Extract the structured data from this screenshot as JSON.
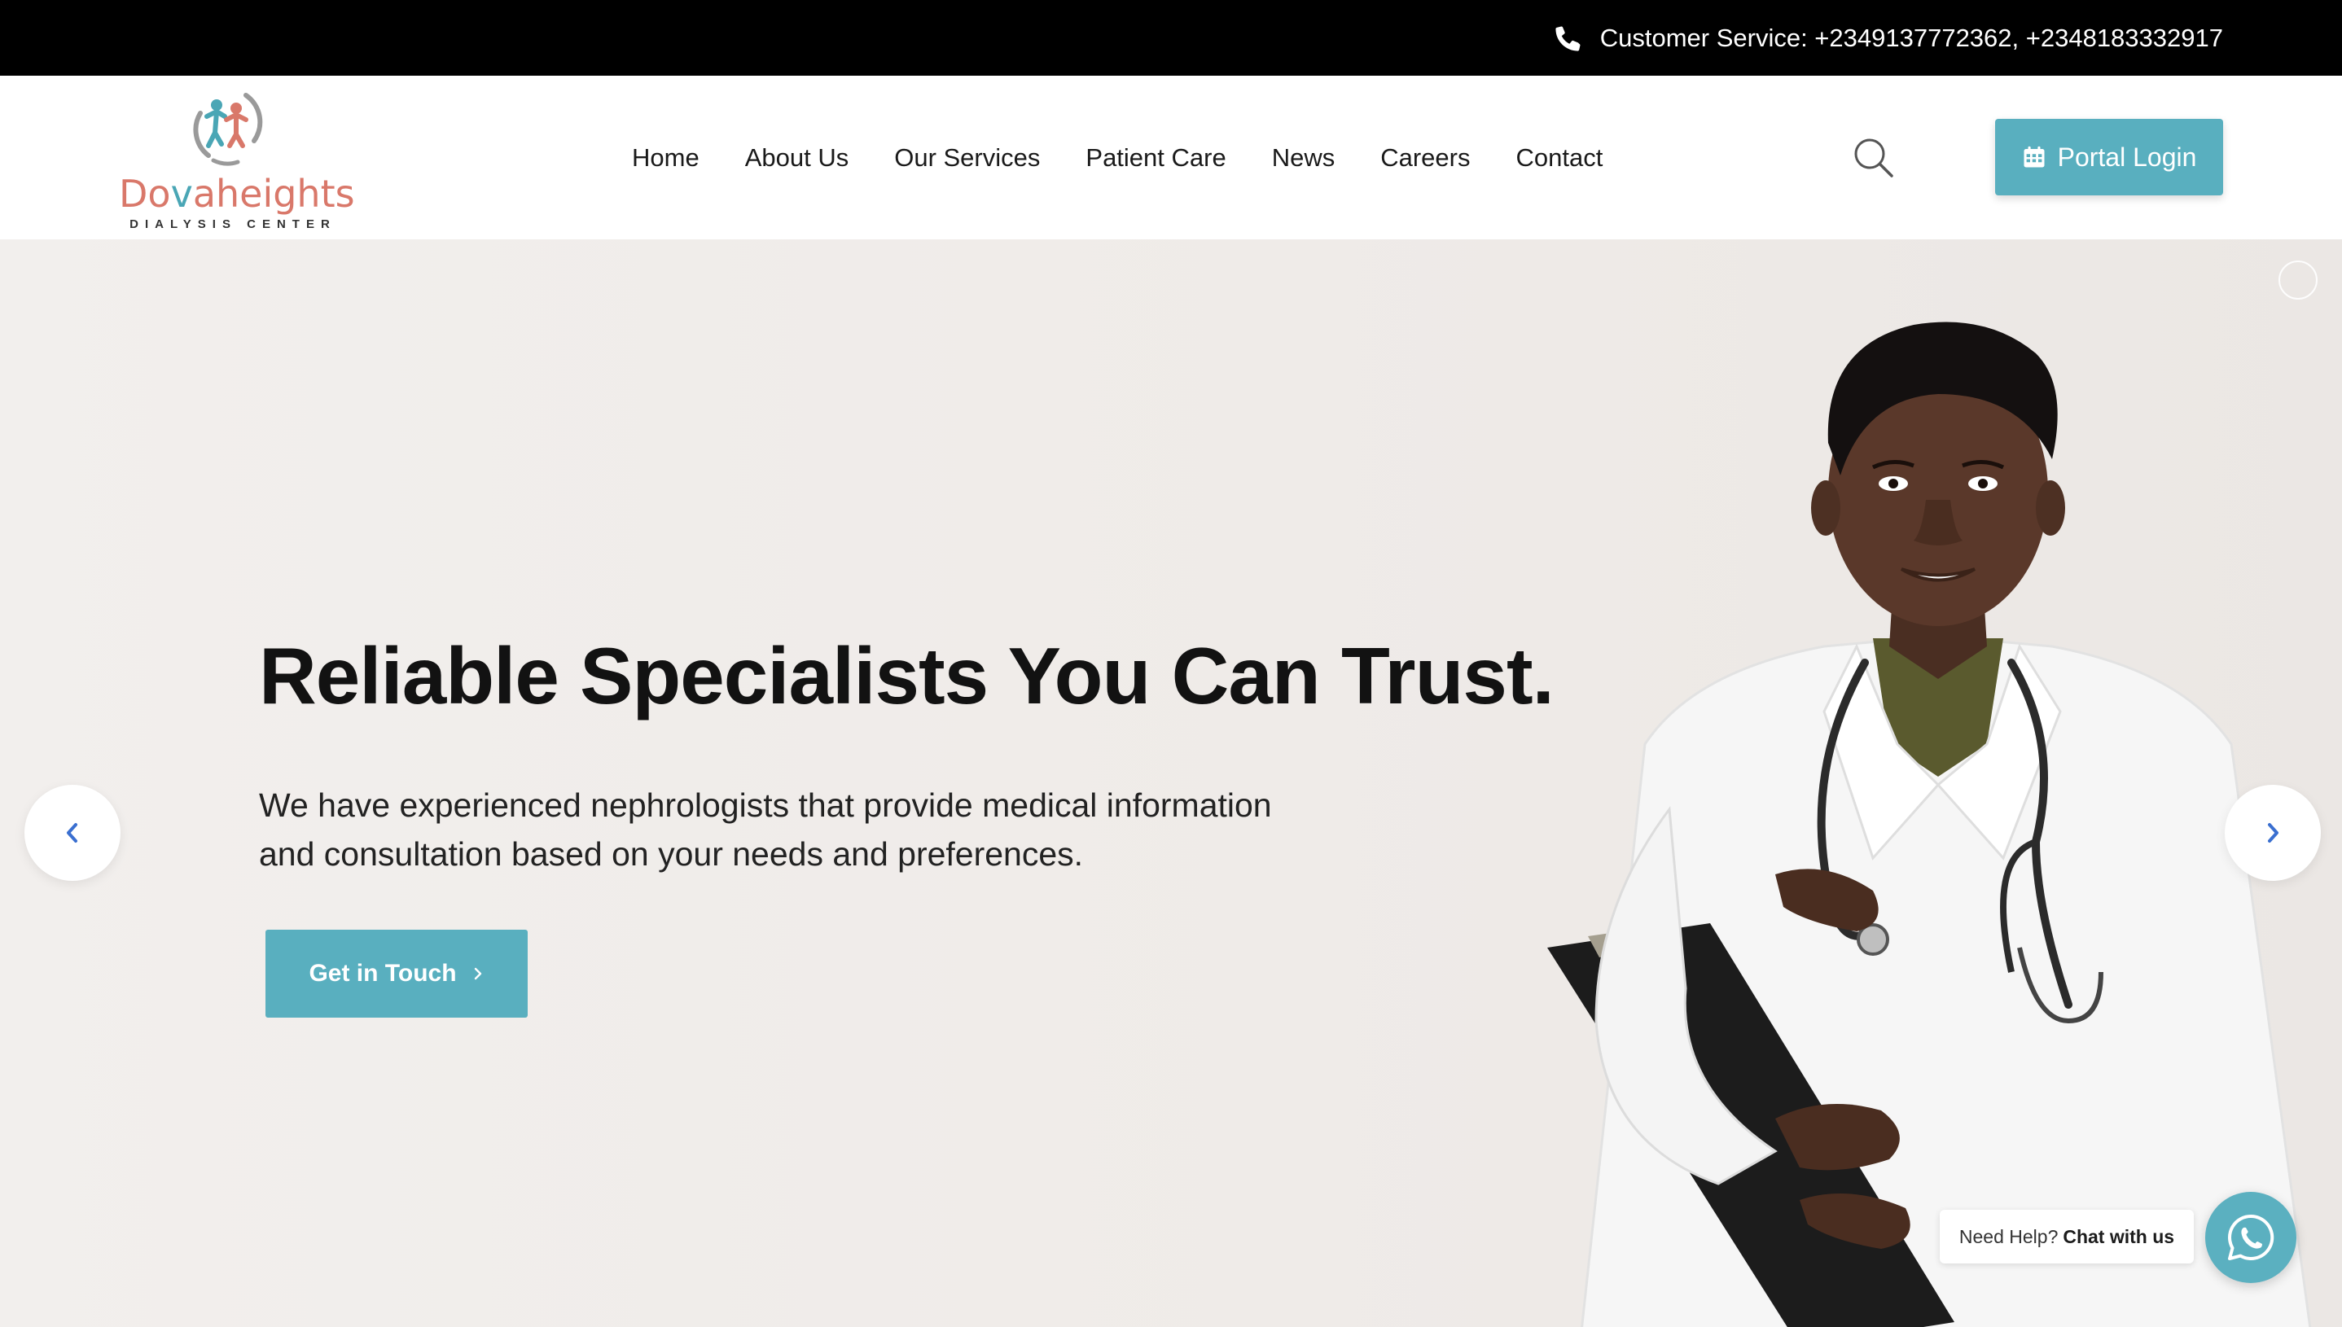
{
  "topbar": {
    "customer_service": "Customer Service: +2349137772362, +2348183332917",
    "icon": "phone-icon"
  },
  "brand": {
    "name_part1": "Do",
    "name_part2": "v",
    "name_part3": "aheights",
    "subtitle": "DIALYSIS CENTER",
    "colors": {
      "coral": "#d9786a",
      "teal": "#4aa6b5"
    }
  },
  "nav": {
    "items": [
      {
        "label": "Home"
      },
      {
        "label": "About Us"
      },
      {
        "label": "Our Services"
      },
      {
        "label": "Patient Care"
      },
      {
        "label": "News"
      },
      {
        "label": "Careers"
      },
      {
        "label": "Contact"
      }
    ],
    "search_icon": "search-icon",
    "portal_label": "Portal Login",
    "portal_icon": "calendar-icon"
  },
  "hero": {
    "title": "Reliable Specialists You Can Trust.",
    "description": "We have experienced nephrologists that provide medical information and consultation based on your needs and preferences.",
    "cta_label": "Get in Touch",
    "prev_icon": "chevron-left-icon",
    "next_icon": "chevron-right-icon"
  },
  "chat": {
    "prefix": "Need Help?",
    "action": "Chat with us",
    "icon": "whatsapp-icon"
  },
  "theme": {
    "accent": "#59afbf",
    "topbar_bg": "#000000",
    "arrow_color": "#3a6fd0"
  }
}
